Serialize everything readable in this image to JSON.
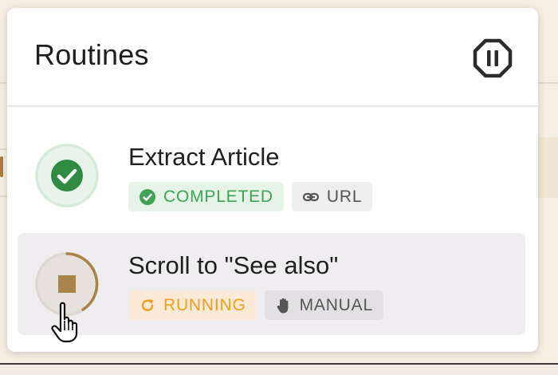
{
  "panel": {
    "title": "Routines",
    "pause_icon": "pause-circle-icon"
  },
  "routines": [
    {
      "name": "Extract Article",
      "status": "COMPLETED",
      "status_icon": "check-circle-icon",
      "trigger": "URL",
      "trigger_icon": "link-icon"
    },
    {
      "name": "Scroll to \"See also\"",
      "status": "RUNNING",
      "status_icon": "refresh-icon",
      "trigger": "MANUAL",
      "trigger_icon": "hand-icon",
      "control_icon": "stop-icon"
    }
  ],
  "colors": {
    "completed": "#3fa256",
    "running": "#f29c1a",
    "progress_ring": "#a8844a"
  }
}
